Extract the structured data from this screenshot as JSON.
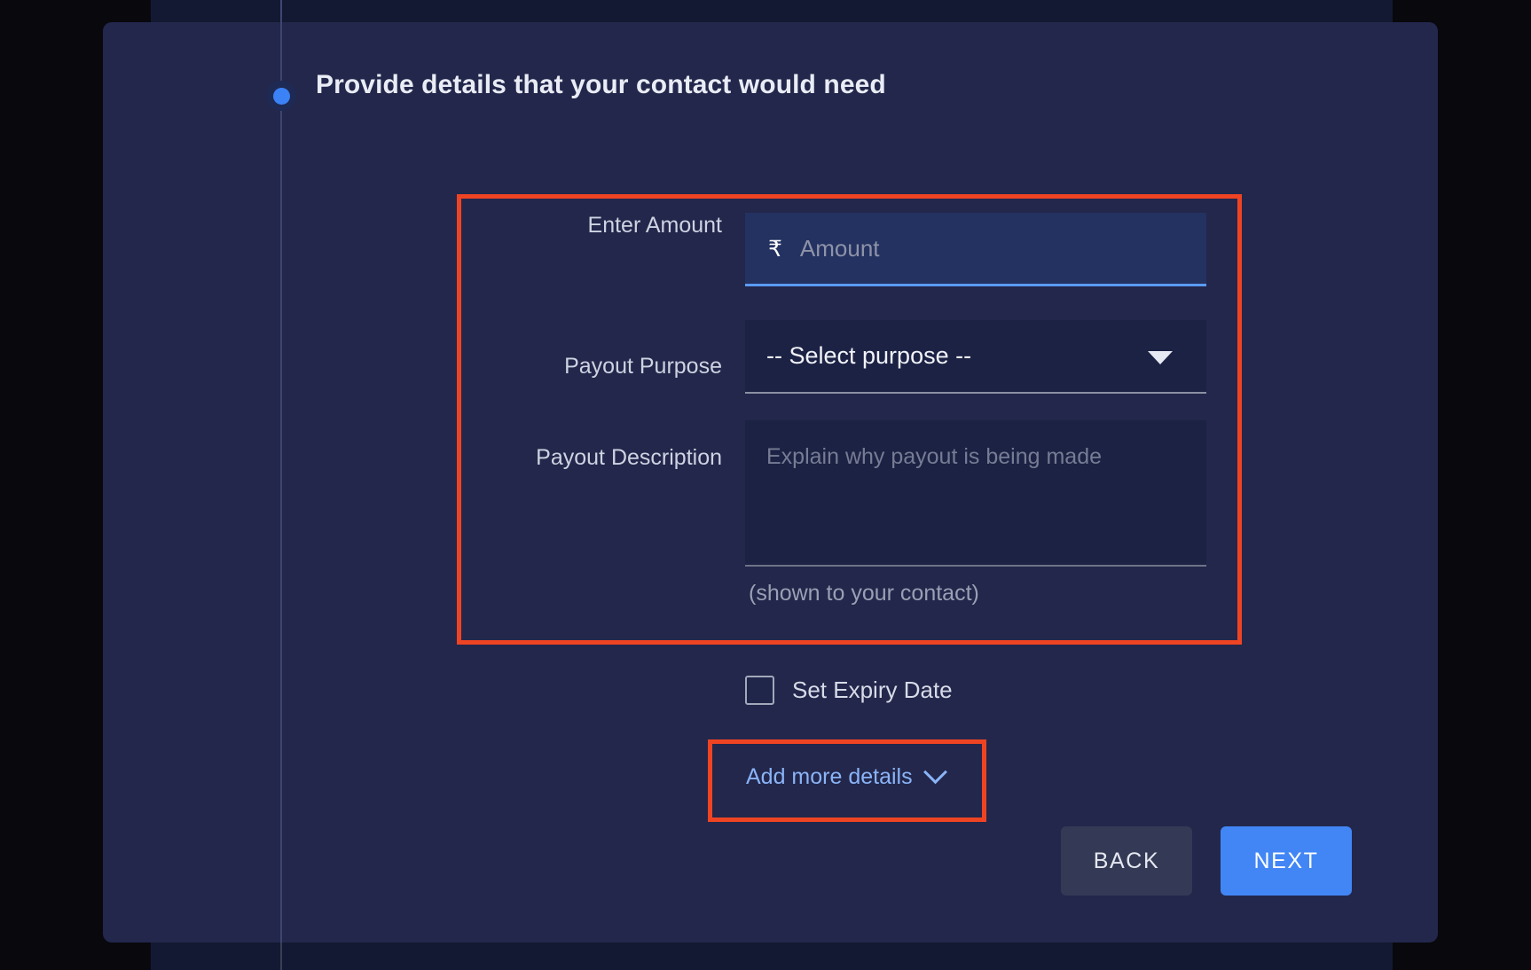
{
  "step": {
    "title": "Provide details that your contact would need",
    "dot_color": "#3b82f6",
    "active": true
  },
  "form": {
    "amount": {
      "label": "Enter Amount",
      "currency_symbol": "₹",
      "value": "",
      "placeholder": "Amount",
      "focused": true,
      "focus_color": "#5b9bf8"
    },
    "purpose": {
      "label": "Payout Purpose",
      "selected": "-- Select purpose --",
      "caret_icon": "chevron-down-icon"
    },
    "description": {
      "label": "Payout Description",
      "value": "",
      "placeholder": "Explain why payout is being made",
      "helper": "(shown to your contact)"
    },
    "expiry": {
      "label": "Set Expiry Date",
      "checked": false
    },
    "add_more": {
      "label": "Add more details",
      "icon": "chevron-down-icon",
      "color": "#8ab4f8"
    }
  },
  "footer": {
    "back_label": "BACK",
    "next_label": "NEXT",
    "next_color": "#4286f5",
    "back_color": "#343a56"
  },
  "annotations": {
    "color": "#ef4423",
    "boxes": [
      {
        "name": "payout-fields-highlight"
      },
      {
        "name": "add-more-details-highlight"
      }
    ]
  },
  "theme": {
    "page_background": "#141933",
    "card_background": "#23274b",
    "outer_background": "#08080d"
  }
}
